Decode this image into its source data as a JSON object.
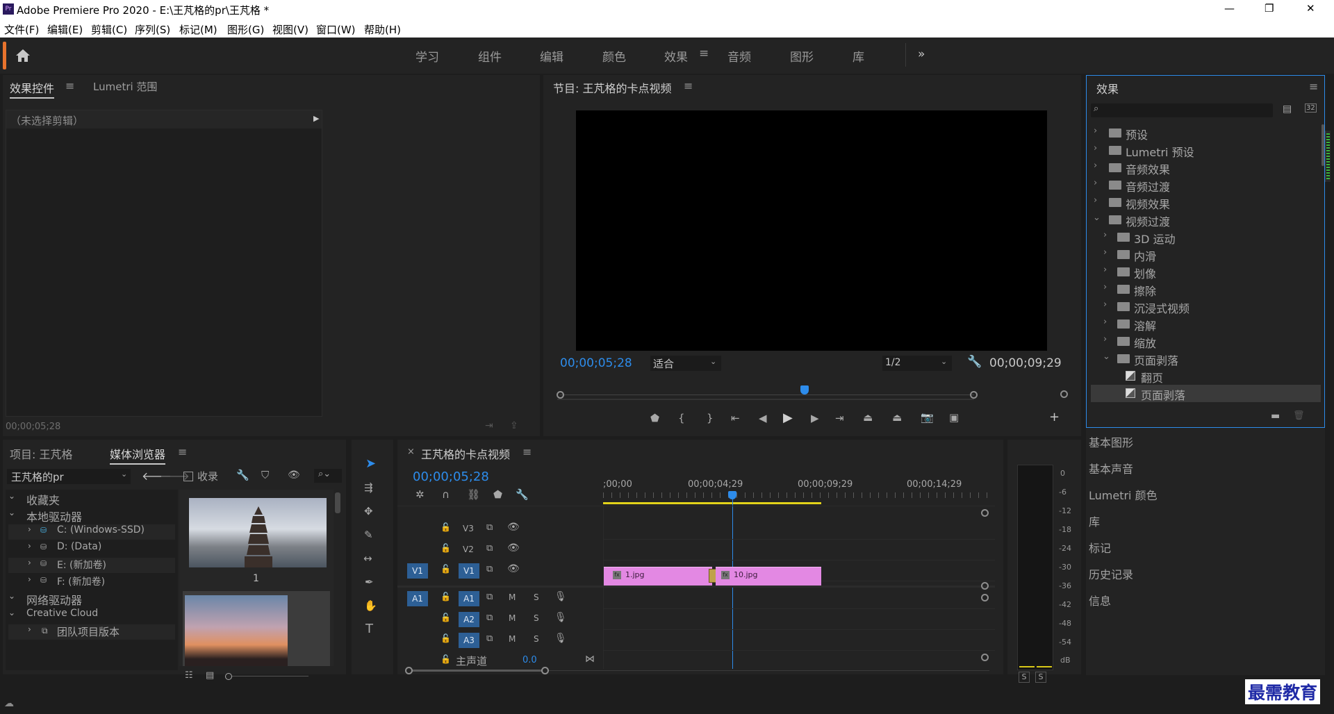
{
  "window": {
    "title": "Adobe Premiere Pro 2020 - E:\\王芃格的pr\\王芃格 *",
    "min": "—",
    "max": "❐",
    "close": "✕",
    "app_icon": "Pr"
  },
  "menu": [
    "文件(F)",
    "编辑(E)",
    "剪辑(C)",
    "序列(S)",
    "标记(M)",
    "图形(G)",
    "视图(V)",
    "窗口(W)",
    "帮助(H)"
  ],
  "workspaces": [
    "学习",
    "组件",
    "编辑",
    "颜色",
    "效果",
    "音频",
    "图形",
    "库"
  ],
  "workspace_active": "效果",
  "workspace_menu": "≡",
  "workspace_more": "»",
  "effect_controls": {
    "tab": "效果控件",
    "tab2": "Lumetri 范围",
    "menu": "≡",
    "placeholder": "（未选择剪辑）",
    "timecode": "00;00;05;28"
  },
  "program": {
    "title": "节目: 王芃格的卡点视频",
    "menu": "≡",
    "timecode_left": "00;00;05;28",
    "fit": "适合",
    "quality": "1/2",
    "timecode_right": "00;00;09;29"
  },
  "effects_panel": {
    "title": "效果",
    "menu": "≡",
    "items": [
      "预设",
      "Lumetri 预设",
      "音频效果",
      "音频过渡",
      "视频效果",
      "视频过渡",
      "3D 运动",
      "内滑",
      "划像",
      "擦除",
      "沉浸式视频",
      "溶解",
      "缩放",
      "页面剥落",
      "翻页",
      "页面剥落"
    ]
  },
  "right_panels": [
    "基本图形",
    "基本声音",
    "Lumetri 颜色",
    "库",
    "标记",
    "历史记录",
    "信息"
  ],
  "project": {
    "tab1": "项目: 王芃格",
    "tab2": "媒体浏览器",
    "menu": "≡",
    "path": "王芃格的pr",
    "collect": "收录",
    "tree": [
      "收藏夹",
      "本地驱动器",
      "C: (Windows-SSD)",
      "D: (Data)",
      "E: (新加卷)",
      "F: (新加卷)",
      "网络驱动器",
      "Creative Cloud",
      "团队项目版本"
    ],
    "thumb1_label": "1"
  },
  "timeline": {
    "tab": "王芃格的卡点视频",
    "close": "×",
    "menu": "≡",
    "timecode": "00;00;05;28",
    "ruler": [
      ";00;00",
      "00;00;04;29",
      "00;00;09;29",
      "00;00;14;29"
    ],
    "video_tracks": [
      "V3",
      "V2",
      "V1"
    ],
    "audio_tracks": [
      "A1",
      "A2",
      "A3"
    ],
    "src_v": "V1",
    "src_a": "A1",
    "master": "主声道",
    "master_val": "0.0",
    "clips": [
      "1.jpg",
      "10.jpg"
    ],
    "m": "M",
    "s": "S"
  },
  "meter": {
    "scale": [
      "0",
      "-6",
      "-12",
      "-18",
      "-24",
      "-30",
      "-36",
      "-42",
      "-48",
      "-54",
      "dB"
    ],
    "solo": [
      "S",
      "S"
    ]
  },
  "watermark": "最需教育",
  "colors": {
    "accent": "#2d8ceb",
    "clip": "#e388e3",
    "track_btn": "#2d5f95"
  }
}
